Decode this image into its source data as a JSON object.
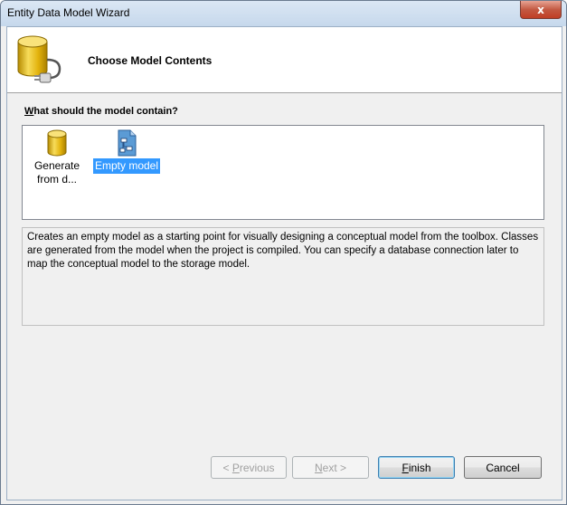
{
  "window": {
    "title": "Entity Data Model Wizard",
    "close_glyph": "x"
  },
  "header": {
    "title": "Choose Model Contents",
    "icon": "database-plug-icon"
  },
  "question": {
    "mnemonic": "W",
    "rest": "hat should the model contain?"
  },
  "options": [
    {
      "label_line1": "Generate",
      "label_line2": "from d...",
      "icon": "database-icon",
      "selected": false
    },
    {
      "label": "Empty model",
      "icon": "empty-model-icon",
      "selected": true
    }
  ],
  "description": "Creates an empty model as a starting point for visually designing a conceptual model from the toolbox. Classes are generated from the model when the project is compiled. You can specify a database connection later to map the conceptual model to the storage model.",
  "buttons": {
    "previous": {
      "prefix": "< ",
      "mnemonic": "P",
      "rest": "revious"
    },
    "next": {
      "mnemonic": "N",
      "rest": "ext >"
    },
    "finish": {
      "mnemonic": "F",
      "rest": "inish"
    },
    "cancel": {
      "label": "Cancel"
    }
  },
  "colors": {
    "selection": "#3399ff",
    "title_bar": "#c6d8ec",
    "close_button": "#c03d24",
    "database_gold": "#e2b20c"
  }
}
